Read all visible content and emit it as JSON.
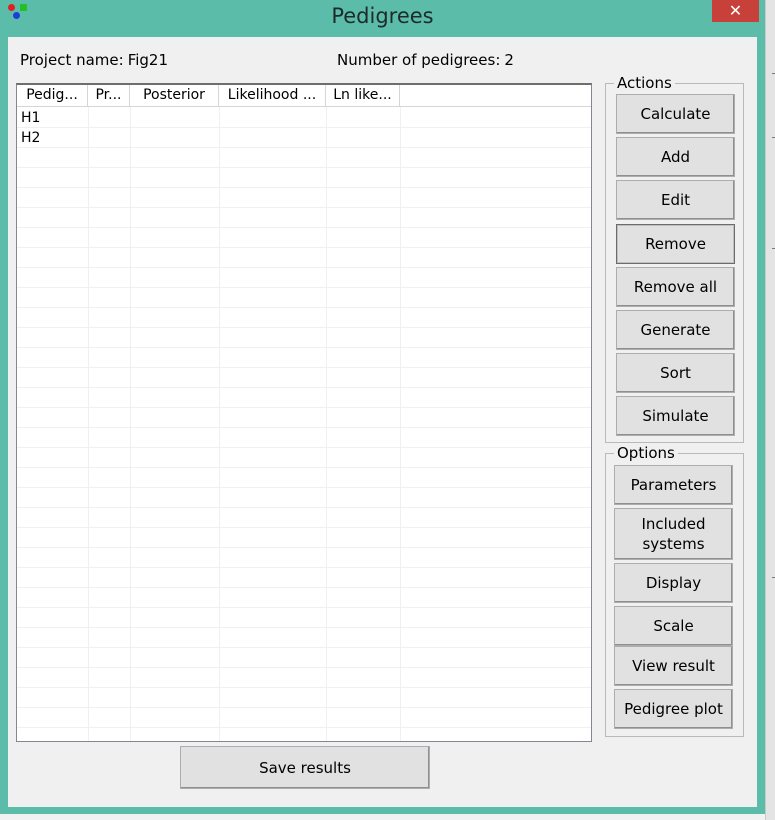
{
  "window": {
    "title": "Pedigrees",
    "close_label": "✕"
  },
  "info": {
    "project_label": "Project name:",
    "project_value": "Fig21",
    "count_label": "Number of pedigrees:",
    "count_value": "2"
  },
  "table": {
    "columns": [
      "Pedig...",
      "Pr...",
      "Posterior",
      "Likelihood ...",
      "Ln like..."
    ],
    "rows": [
      {
        "pedigree": "H1"
      },
      {
        "pedigree": "H2"
      }
    ]
  },
  "actions": {
    "title": "Actions",
    "buttons": [
      "Calculate",
      "Add",
      "Edit",
      "Remove",
      "Remove all",
      "Generate",
      "Sort",
      "Simulate"
    ]
  },
  "options": {
    "title": "Options",
    "buttons": [
      "Parameters",
      "Included systems",
      "Display",
      "Scale",
      "View result",
      "Pedigree plot"
    ]
  },
  "footer": {
    "save_label": "Save results"
  }
}
